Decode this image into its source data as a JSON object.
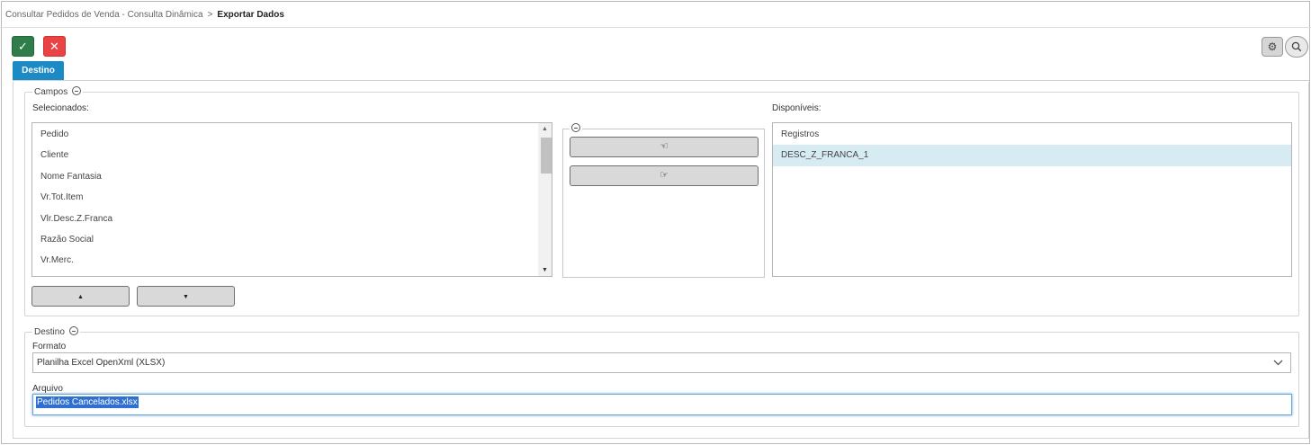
{
  "breadcrumb": {
    "parent": "Consultar Pedidos de Venda - Consulta Dinâmica",
    "separator": ">",
    "current": "Exportar Dados"
  },
  "toolbar": {
    "confirm_icon": "✓",
    "cancel_icon": "✕",
    "settings_icon": "⚙",
    "search_icon": "⚲"
  },
  "tabs": {
    "active": "Destino"
  },
  "campos": {
    "legend": "Campos",
    "selected_label": "Selecionados:",
    "available_label": "Disponíveis:",
    "selected_items": [
      "Pedido",
      "Cliente",
      "Nome Fantasia",
      "Vr.Tot.Item",
      "Vlr.Desc.Z.Franca",
      "Razão Social",
      "Vr.Merc."
    ],
    "available_items": [
      "Registros",
      "DESC_Z_FRANCA_1"
    ],
    "available_selected_index": 1,
    "move_left_icon": "☜",
    "move_right_icon": "☞",
    "move_up_icon": "▲",
    "move_down_icon": "▼"
  },
  "destino": {
    "legend": "Destino",
    "format_label": "Formato",
    "format_value": "Planilha Excel OpenXml (XLSX)",
    "file_label": "Arquivo",
    "file_value": "Pedidos Cancelados.xlsx"
  }
}
